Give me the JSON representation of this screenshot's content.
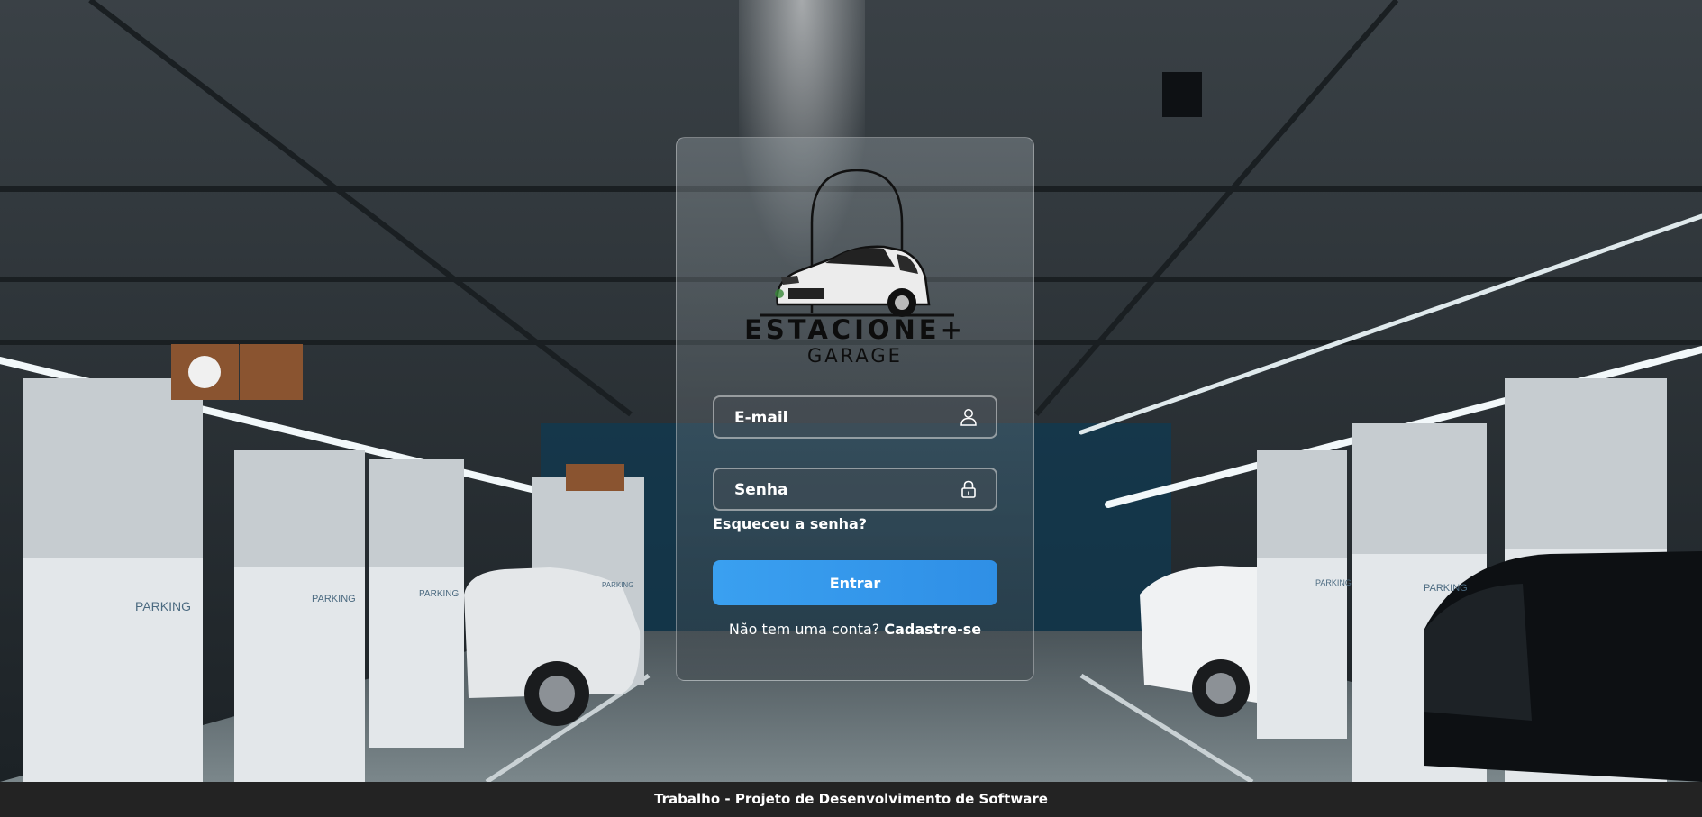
{
  "brand": {
    "name": "ESTACIONE+",
    "subtitle": "GARAGE"
  },
  "login": {
    "email_placeholder": "E-mail",
    "password_placeholder": "Senha",
    "forgot_label": "Esqueceu a senha?",
    "submit_label": "Entrar",
    "no_account_text": "Não tem uma conta?",
    "signup_label": "Cadastre-se"
  },
  "background_signs": [
    "PARKING",
    "PARKING",
    "PARKING",
    "PARKING",
    "PARKING",
    "PARKING"
  ],
  "footer": {
    "text": "Trabalho - Projeto de Desenvolvimento de Software"
  },
  "colors": {
    "accent": "#3aa0f0",
    "footer_bg": "#232323"
  },
  "icons": {
    "email": "user-icon",
    "password": "lock-icon"
  }
}
